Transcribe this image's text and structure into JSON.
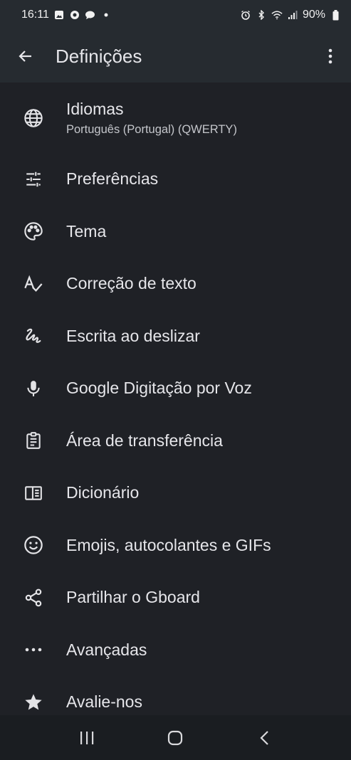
{
  "status": {
    "time": "16:11",
    "battery": "90%",
    "left_icons": [
      "gallery-icon",
      "chrome-icon",
      "chat-icon",
      "dot-icon"
    ],
    "right_icons": [
      "alarm-icon",
      "bluetooth-icon",
      "wifi-icon",
      "signal-icon",
      "battery-icon"
    ]
  },
  "appbar": {
    "title": "Definições"
  },
  "settings": [
    {
      "icon": "globe-icon",
      "label": "Idiomas",
      "subtitle": "Português (Portugal) (QWERTY)"
    },
    {
      "icon": "sliders-icon",
      "label": "Preferências"
    },
    {
      "icon": "palette-icon",
      "label": "Tema"
    },
    {
      "icon": "spellcheck-icon",
      "label": "Correção de texto"
    },
    {
      "icon": "gesture-icon",
      "label": "Escrita ao deslizar"
    },
    {
      "icon": "mic-icon",
      "label": "Google Digitação por Voz"
    },
    {
      "icon": "clipboard-icon",
      "label": "Área de transferência"
    },
    {
      "icon": "book-icon",
      "label": "Dicionário"
    },
    {
      "icon": "emoji-icon",
      "label": "Emojis, autocolantes e GIFs"
    },
    {
      "icon": "share-icon",
      "label": "Partilhar o Gboard"
    },
    {
      "icon": "more-horiz-icon",
      "label": "Avançadas"
    },
    {
      "icon": "star-icon",
      "label": "Avalie-nos"
    }
  ],
  "nav": [
    "recents-icon",
    "home-icon",
    "back-nav-icon"
  ],
  "colors": {
    "background": "#1f2126",
    "bar": "#262b30",
    "text": "#e6e6ea",
    "subtext": "#c4c6cb"
  }
}
